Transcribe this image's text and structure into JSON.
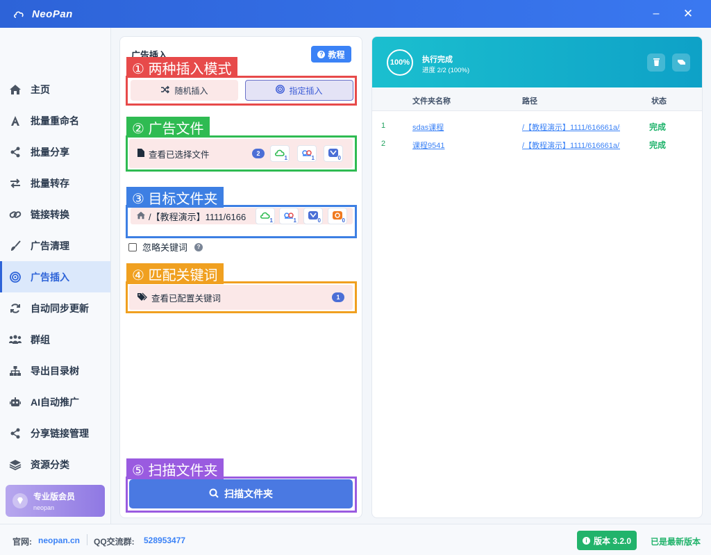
{
  "app": {
    "name": "NeoPan"
  },
  "window": {
    "minimize": "–",
    "close": "✕"
  },
  "sidebar": {
    "items": [
      {
        "label": "主页",
        "icon": "home-icon"
      },
      {
        "label": "批量重命名",
        "icon": "font-icon"
      },
      {
        "label": "批量分享",
        "icon": "share-icon"
      },
      {
        "label": "批量转存",
        "icon": "exchange-icon"
      },
      {
        "label": "链接转换",
        "icon": "link-icon"
      },
      {
        "label": "广告清理",
        "icon": "brush-icon"
      },
      {
        "label": "广告插入",
        "icon": "target-icon"
      },
      {
        "label": "自动同步更新",
        "icon": "sync-icon"
      },
      {
        "label": "群组",
        "icon": "users-icon"
      },
      {
        "label": "导出目录树",
        "icon": "sitemap-icon"
      },
      {
        "label": "AI自动推广",
        "icon": "robot-icon"
      },
      {
        "label": "分享链接管理",
        "icon": "share-icon"
      },
      {
        "label": "资源分类",
        "icon": "layers-icon"
      }
    ],
    "active_index": 6,
    "member": {
      "title": "专业版会员",
      "user": "neopan"
    }
  },
  "panel": {
    "title": "广告插入",
    "help_label": "教程",
    "annotations": {
      "mode": "① 两种插入模式",
      "file": "② 广告文件",
      "target": "③ 目标文件夹",
      "keyword": "④ 匹配关键词",
      "scan": "⑤ 扫描文件夹"
    },
    "mode_random": "随机插入",
    "mode_fixed": "指定插入",
    "selected_mode": "指定插入",
    "file_row": {
      "label": "查看已选择文件",
      "count": "2",
      "cloud_counts": [
        "1",
        "1",
        "0"
      ]
    },
    "target_row": {
      "path": "/【教程演示】1111/6166",
      "cloud_counts": [
        "1",
        "1",
        "0",
        "0"
      ]
    },
    "ignore_keywords": {
      "label": "忽略关键词",
      "checked": false
    },
    "keyword_row": {
      "label": "查看已配置关键词",
      "count": "1"
    },
    "scan_button": "扫描文件夹"
  },
  "result": {
    "ring_text": "100%",
    "status": "执行完成",
    "progress_text": "进度 2/2 (100%)",
    "progress_fraction": 1.0,
    "accent": "#1bbfcf",
    "columns": [
      "文件夹名称",
      "路径",
      "状态"
    ],
    "rows": [
      {
        "idx": "1",
        "name": "sdas课程",
        "path": "/【教程演示】1111/616661a/s",
        "status": "完成"
      },
      {
        "idx": "2",
        "name": "课程9541",
        "path": "/【教程演示】1111/616661a/1",
        "status": "完成"
      }
    ]
  },
  "footer": {
    "site_label": "官网:",
    "site": "neopan.cn",
    "qq_label": "QQ交流群:",
    "qq": "528953477",
    "version": "版本 3.2.0",
    "latest": "已是最新版本"
  }
}
